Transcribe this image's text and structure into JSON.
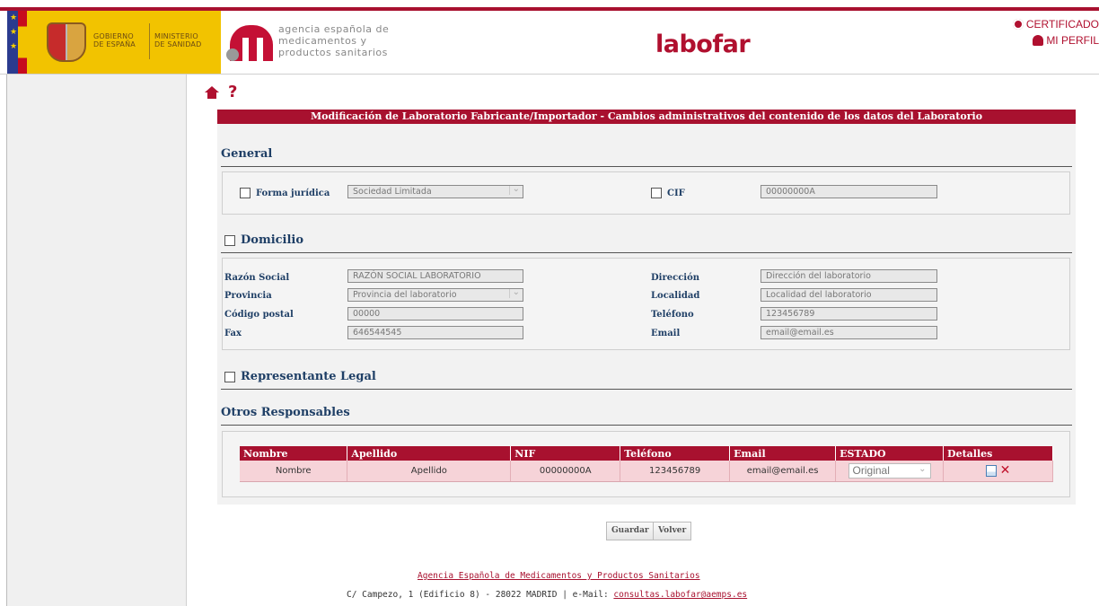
{
  "header": {
    "gobierno": [
      "GOBIERNO",
      "DE ESPAÑA"
    ],
    "ministerio": [
      "MINISTERIO",
      "DE SANIDAD"
    ],
    "aemps_lines": [
      "agencia española de",
      "medicamentos y",
      "productos sanitarios"
    ],
    "app_name": "labofar",
    "certificado": "CERTIFICADO",
    "mi_perfil": "MI PERFIL",
    "accent_color": "#a8112f"
  },
  "page": {
    "title": "Modificación de Laboratorio Fabricante/Importador - Cambios administrativos del contenido de los datos del Laboratorio"
  },
  "general": {
    "title": "General",
    "forma_label": "Forma jurídica",
    "forma_value": "Sociedad Limitada",
    "cif_label": "CIF",
    "cif_value": "00000000A"
  },
  "domicilio": {
    "title": "Domicilio",
    "razon_label": "Razón Social",
    "razon_value": "RAZÓN SOCIAL LABORATORIO",
    "provincia_label": "Provincia",
    "provincia_value": "Provincia del laboratorio",
    "cp_label": "Código postal",
    "cp_value": "00000",
    "fax_label": "Fax",
    "fax_value": "646544545",
    "direccion_label": "Dirección",
    "direccion_value": "Dirección del laboratorio",
    "localidad_label": "Localidad",
    "localidad_value": "Localidad del laboratorio",
    "telefono_label": "Teléfono",
    "telefono_value": "123456789",
    "email_label": "Email",
    "email_value": "email@email.es"
  },
  "representante": {
    "title": "Representante Legal"
  },
  "otros": {
    "title": "Otros Responsables",
    "columns": [
      "Nombre",
      "Apellido",
      "NIF",
      "Teléfono",
      "Email",
      "ESTADO",
      "Detalles"
    ],
    "row": {
      "nombre": "Nombre",
      "apellido": "Apellido",
      "nif": "00000000A",
      "telefono": "123456789",
      "email": "email@email.es",
      "estado": "Original"
    }
  },
  "buttons": {
    "guardar": "Guardar",
    "volver": "Volver"
  },
  "footer": {
    "agency_link": "Agencia Española de Medicamentos y Productos Sanitarios",
    "address": "C/ Campezo, 1 (Edificio 8) - 28022 MADRID | e-Mail: ",
    "email": "consultas.labofar@aemps.es"
  }
}
